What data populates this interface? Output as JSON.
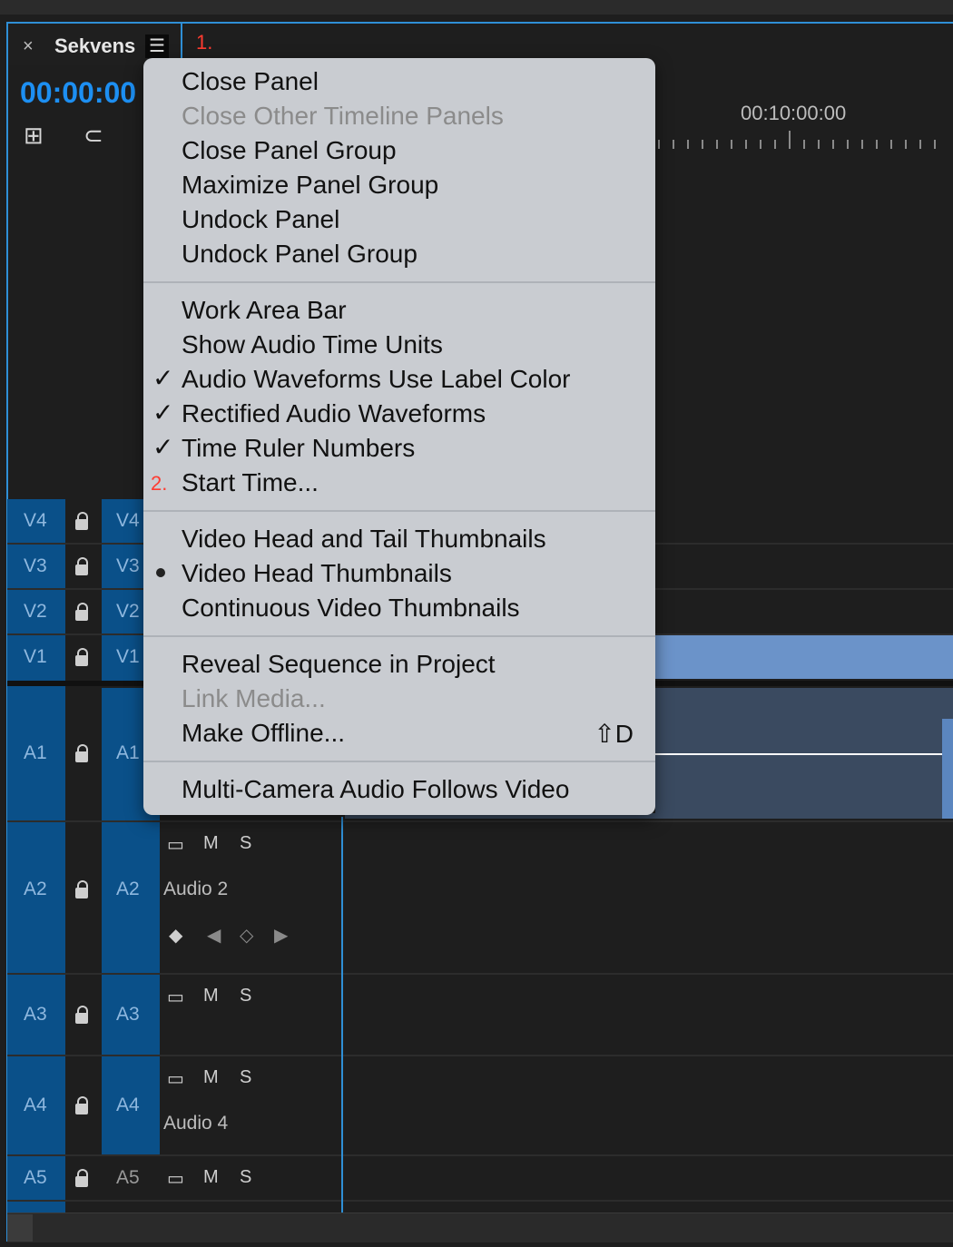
{
  "tab": {
    "close_glyph": "×",
    "title": "Sekvens",
    "menu_glyph": "☰"
  },
  "callouts": {
    "one": "1.",
    "two": "2."
  },
  "timecode": "00:00:00",
  "ruler": {
    "label": "00:10:00:00"
  },
  "tracks": {
    "video": [
      {
        "id": "V4",
        "target": "V4"
      },
      {
        "id": "V3",
        "target": "V3"
      },
      {
        "id": "V2",
        "target": "V2"
      },
      {
        "id": "V1",
        "target": "V1"
      }
    ],
    "audio": [
      {
        "id": "A1",
        "target": "A1"
      },
      {
        "id": "A2",
        "target": "A2",
        "name": "Audio 2"
      },
      {
        "id": "A3",
        "target": "A3"
      },
      {
        "id": "A4",
        "target": "A4",
        "name": "Audio 4"
      },
      {
        "id": "A5",
        "target": "A5"
      }
    ],
    "mute_label": "M",
    "solo_label": "S"
  },
  "menu": {
    "items": [
      {
        "label": "Close Panel",
        "enabled": true
      },
      {
        "label": "Close Other Timeline Panels",
        "enabled": false
      },
      {
        "label": "Close Panel Group",
        "enabled": true
      },
      {
        "label": "Maximize Panel Group",
        "enabled": true
      },
      {
        "label": "Undock Panel",
        "enabled": true
      },
      {
        "label": "Undock Panel Group",
        "enabled": true
      },
      {
        "label": "Work Area Bar",
        "enabled": true
      },
      {
        "label": "Show Audio Time Units",
        "enabled": true
      },
      {
        "label": "Audio Waveforms Use Label Color",
        "enabled": true,
        "checked": true
      },
      {
        "label": "Rectified Audio Waveforms",
        "enabled": true,
        "checked": true
      },
      {
        "label": "Time Ruler Numbers",
        "enabled": true,
        "checked": true
      },
      {
        "label": "Start Time...",
        "enabled": true
      },
      {
        "label": "Video Head and Tail Thumbnails",
        "enabled": true
      },
      {
        "label": "Video Head Thumbnails",
        "enabled": true,
        "selected": true
      },
      {
        "label": "Continuous Video Thumbnails",
        "enabled": true
      },
      {
        "label": "Reveal Sequence in Project",
        "enabled": true
      },
      {
        "label": "Link Media...",
        "enabled": false
      },
      {
        "label": "Make Offline...",
        "enabled": true,
        "shortcut": "⇧D"
      },
      {
        "label": "Multi-Camera Audio Follows Video",
        "enabled": true
      }
    ],
    "check_glyph": "✓"
  }
}
